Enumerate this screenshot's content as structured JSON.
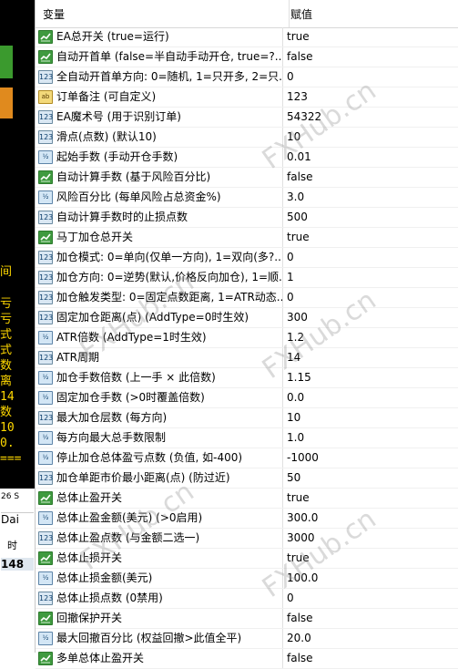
{
  "header": {
    "name_label": "变量",
    "value_label": "赋值"
  },
  "left_strip": {
    "fragments": [
      "间",
      "亏",
      "亏",
      "式",
      "式",
      "数",
      "离",
      "14",
      "数",
      "10",
      "0.",
      "==="
    ],
    "bottom_labels": [
      "26 S",
      "Dai",
      "时",
      "148"
    ]
  },
  "watermark": "FXHub.cn",
  "params": [
    {
      "icon": "bool",
      "icon_text": "",
      "name": "EA总开关 (true=运行)",
      "value": "true"
    },
    {
      "icon": "bool",
      "icon_text": "",
      "name": "自动开首单 (false=半自动手动开仓, true=?...",
      "value": "false"
    },
    {
      "icon": "int",
      "icon_text": "123",
      "name": "全自动开首单方向: 0=随机, 1=只开多, 2=只...",
      "value": "0"
    },
    {
      "icon": "str",
      "icon_text": "ab",
      "name": "订单备注 (可自定义)",
      "value": "123"
    },
    {
      "icon": "int",
      "icon_text": "123",
      "name": "EA魔术号 (用于识别订单)",
      "value": "54322"
    },
    {
      "icon": "int",
      "icon_text": "123",
      "name": "滑点(点数) (默认10)",
      "value": "10"
    },
    {
      "icon": "dbl",
      "icon_text": "½",
      "name": "起始手数 (手动开仓手数)",
      "value": "0.01"
    },
    {
      "icon": "bool",
      "icon_text": "",
      "name": "自动计算手数 (基于风险百分比)",
      "value": "false"
    },
    {
      "icon": "dbl",
      "icon_text": "½",
      "name": "风险百分比 (每单风险占总资金%)",
      "value": "3.0"
    },
    {
      "icon": "int",
      "icon_text": "123",
      "name": "自动计算手数时的止损点数",
      "value": "500"
    },
    {
      "icon": "bool",
      "icon_text": "",
      "name": "马丁加仓总开关",
      "value": "true"
    },
    {
      "icon": "int",
      "icon_text": "123",
      "name": "加仓模式: 0=单向(仅单一方向), 1=双向(多?...",
      "value": "0"
    },
    {
      "icon": "int",
      "icon_text": "123",
      "name": "加仓方向: 0=逆势(默认,价格反向加仓), 1=顺...",
      "value": "1"
    },
    {
      "icon": "int",
      "icon_text": "123",
      "name": "加仓触发类型: 0=固定点数距离, 1=ATR动态...",
      "value": "0"
    },
    {
      "icon": "int",
      "icon_text": "123",
      "name": "固定加仓距离(点) (AddType=0时生效)",
      "value": "300"
    },
    {
      "icon": "dbl",
      "icon_text": "½",
      "name": "ATR倍数 (AddType=1时生效)",
      "value": "1.2"
    },
    {
      "icon": "int",
      "icon_text": "123",
      "name": "ATR周期",
      "value": "14"
    },
    {
      "icon": "dbl",
      "icon_text": "½",
      "name": "加仓手数倍数 (上一手 × 此倍数)",
      "value": "1.15"
    },
    {
      "icon": "dbl",
      "icon_text": "½",
      "name": "固定加仓手数 (>0时覆盖倍数)",
      "value": "0.0"
    },
    {
      "icon": "int",
      "icon_text": "123",
      "name": "最大加仓层数 (每方向)",
      "value": "10"
    },
    {
      "icon": "dbl",
      "icon_text": "½",
      "name": "每方向最大总手数限制",
      "value": "1.0"
    },
    {
      "icon": "dbl",
      "icon_text": "½",
      "name": "停止加仓总体盈亏点数 (负值, 如-400)",
      "value": "-1000"
    },
    {
      "icon": "int",
      "icon_text": "123",
      "name": "加仓单距市价最小距离(点) (防过近)",
      "value": "50"
    },
    {
      "icon": "bool",
      "icon_text": "",
      "name": "总体止盈开关",
      "value": "true"
    },
    {
      "icon": "dbl",
      "icon_text": "½",
      "name": "总体止盈金额(美元) (>0启用)",
      "value": "300.0"
    },
    {
      "icon": "int",
      "icon_text": "123",
      "name": "总体止盈点数 (与金额二选一)",
      "value": "3000"
    },
    {
      "icon": "bool",
      "icon_text": "",
      "name": "总体止损开关",
      "value": "true"
    },
    {
      "icon": "dbl",
      "icon_text": "½",
      "name": "总体止损金额(美元)",
      "value": "100.0"
    },
    {
      "icon": "int",
      "icon_text": "123",
      "name": "总体止损点数 (0禁用)",
      "value": "0"
    },
    {
      "icon": "bool",
      "icon_text": "",
      "name": "回撤保护开关",
      "value": "false"
    },
    {
      "icon": "dbl",
      "icon_text": "½",
      "name": "最大回撤百分比 (权益回撤>此值全平)",
      "value": "20.0"
    },
    {
      "icon": "bool",
      "icon_text": "",
      "name": "多单总体止盈开关",
      "value": "false"
    }
  ]
}
